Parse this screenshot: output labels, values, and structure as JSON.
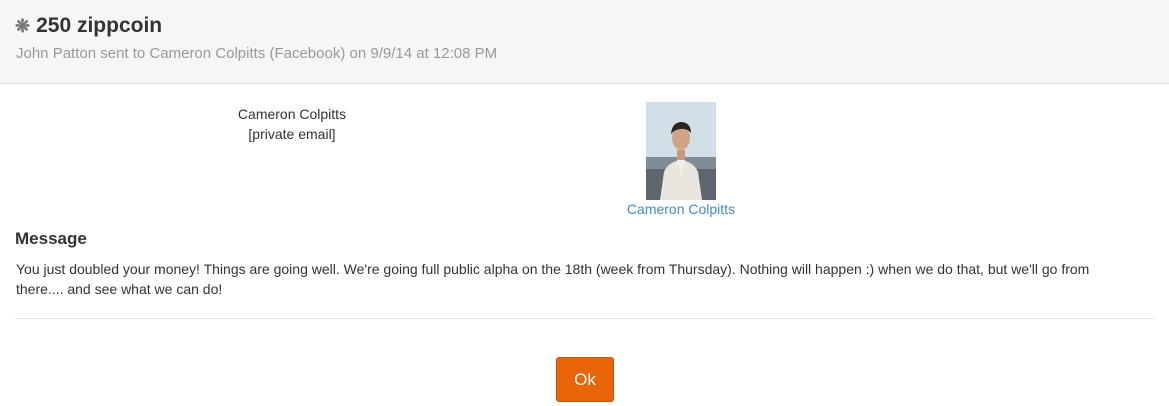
{
  "header": {
    "icon": "asterisk-icon",
    "title": "250 zippcoin",
    "subtitle": "John Patton sent to Cameron Colpitts (Facebook) on 9/9/14 at 12:08 PM"
  },
  "recipient": {
    "name": "Cameron Colpitts",
    "email": "[private email]"
  },
  "profile": {
    "link_name": "Cameron Colpitts"
  },
  "message": {
    "heading": "Message",
    "body": "You just doubled your money! Things are going well. We're going full public alpha on the 18th (week from Thursday). Nothing will happen :) when we do that, but we'll go from there.... and see what we can do!"
  },
  "actions": {
    "ok_label": "Ok"
  },
  "colors": {
    "accent": "#e8650a",
    "link": "#428bca",
    "header_bg": "#f6f6f6"
  }
}
